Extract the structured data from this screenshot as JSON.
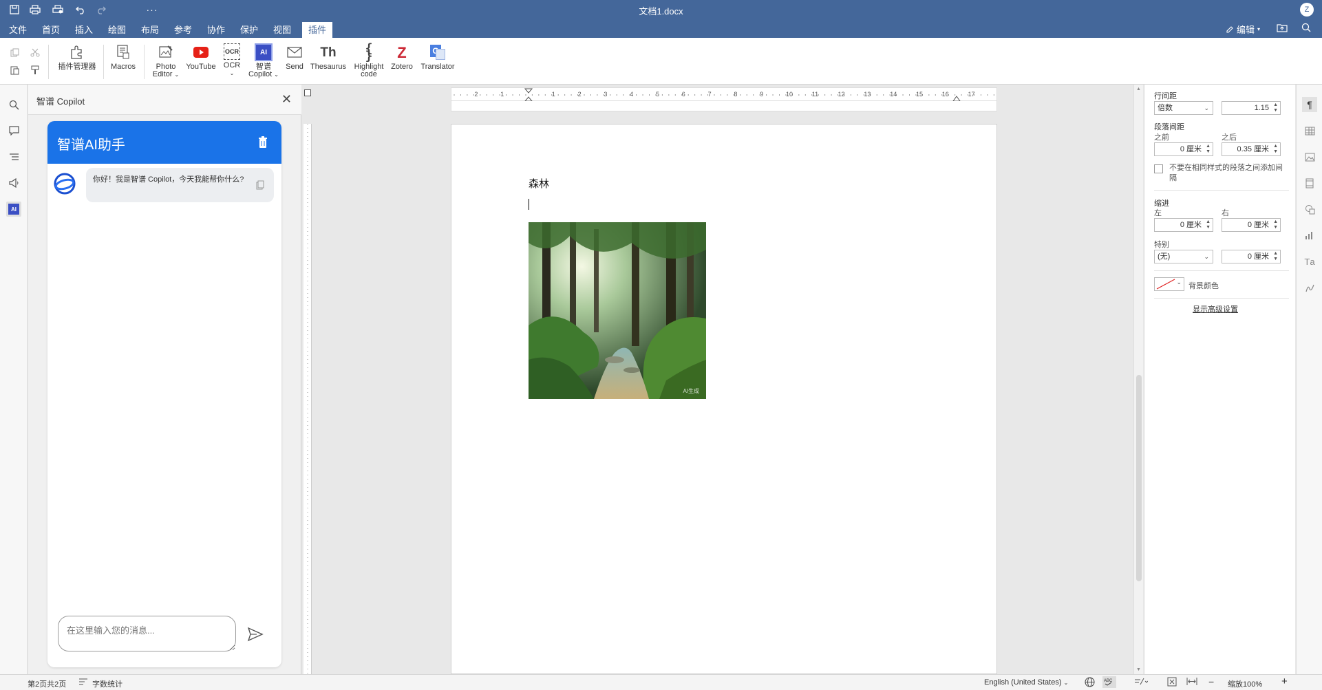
{
  "window": {
    "title": "文档1.docx",
    "user_initial": "Z"
  },
  "menu": {
    "items": [
      "文件",
      "首页",
      "插入",
      "绘图",
      "布局",
      "参考",
      "协作",
      "保护",
      "视图",
      "插件"
    ],
    "active": "插件",
    "edit_label": "编辑"
  },
  "toolbar": {
    "plugin_manager": "插件管理器",
    "macros": "Macros",
    "photo_editor": [
      "Photo",
      "Editor"
    ],
    "youtube": "YouTube",
    "ocr": "OCR",
    "zhipu_copilot": [
      "智谱",
      "Copilot"
    ],
    "send": "Send",
    "thesaurus": "Thesaurus",
    "highlight_code": [
      "Highlight",
      "code"
    ],
    "zotero": "Zotero",
    "translator": "Translator",
    "icon_texts": {
      "ocr": "OCR",
      "ai": "AI",
      "th": "Th",
      "braces": "{ }",
      "zotero": "Z",
      "g": "G"
    }
  },
  "copilot": {
    "panel_title": "智谱 Copilot",
    "header_title": "智谱AI助手",
    "greeting": "你好！我是智谱 Copilot，今天我能帮你什么?",
    "input_placeholder": "在这里输入您的消息..."
  },
  "document": {
    "heading": "森林",
    "image_watermark": "AI生成"
  },
  "paragraph_panel": {
    "line_spacing_label": "行间距",
    "line_spacing_mode": "倍数",
    "line_spacing_value": "1.15",
    "para_spacing_label": "段落间距",
    "before_label": "之前",
    "after_label": "之后",
    "before_value": "0 厘米",
    "after_value": "0.35 厘米",
    "no_space_same_style": "不要在相同样式的段落之间添加间隔",
    "indent_label": "缩进",
    "left_label": "左",
    "right_label": "右",
    "left_value": "0 厘米",
    "right_value": "0 厘米",
    "special_label": "特别",
    "special_mode": "(无)",
    "special_value": "0 厘米",
    "bg_color_label": "背景颜色",
    "advanced_link": "显示高级设置"
  },
  "statusbar": {
    "page_info": "第2页共2页",
    "word_count": "字数统计",
    "language": "English (United States)",
    "zoom": "缩放100%"
  },
  "ruler_numbers": [
    "2",
    "1",
    "1",
    "2",
    "3",
    "4",
    "5",
    "6",
    "7",
    "8",
    "9",
    "10",
    "11",
    "12",
    "13",
    "14",
    "15",
    "16",
    "17"
  ],
  "colors": {
    "titlebar": "#44679a",
    "accent": "#1a73e8",
    "youtube": "#e62117",
    "zotero": "#cc2936"
  }
}
